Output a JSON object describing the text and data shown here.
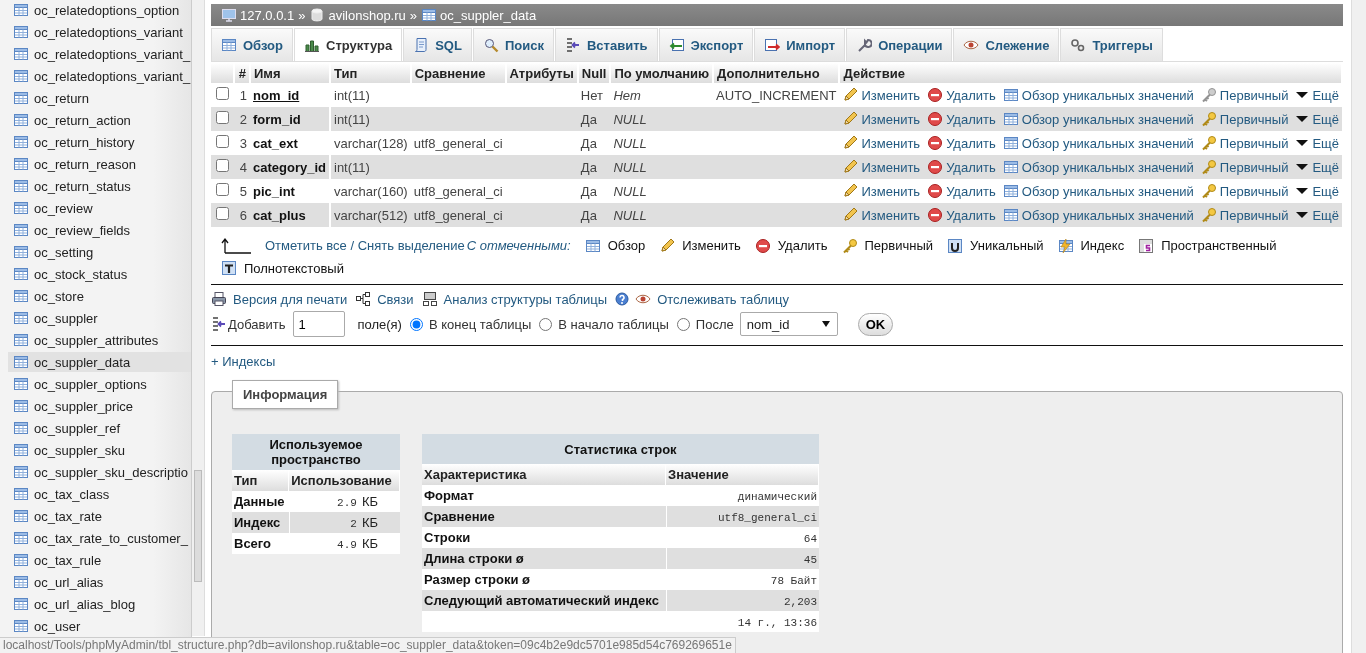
{
  "sidebar": {
    "items": [
      {
        "label": "oc_relatedoptions_option",
        "selected": false
      },
      {
        "label": "oc_relatedoptions_variant",
        "selected": false
      },
      {
        "label": "oc_relatedoptions_variant_",
        "selected": false
      },
      {
        "label": "oc_relatedoptions_variant_",
        "selected": false
      },
      {
        "label": "oc_return",
        "selected": false
      },
      {
        "label": "oc_return_action",
        "selected": false
      },
      {
        "label": "oc_return_history",
        "selected": false
      },
      {
        "label": "oc_return_reason",
        "selected": false
      },
      {
        "label": "oc_return_status",
        "selected": false
      },
      {
        "label": "oc_review",
        "selected": false
      },
      {
        "label": "oc_review_fields",
        "selected": false
      },
      {
        "label": "oc_setting",
        "selected": false
      },
      {
        "label": "oc_stock_status",
        "selected": false
      },
      {
        "label": "oc_store",
        "selected": false
      },
      {
        "label": "oc_suppler",
        "selected": false
      },
      {
        "label": "oc_suppler_attributes",
        "selected": false
      },
      {
        "label": "oc_suppler_data",
        "selected": true
      },
      {
        "label": "oc_suppler_options",
        "selected": false
      },
      {
        "label": "oc_suppler_price",
        "selected": false
      },
      {
        "label": "oc_suppler_ref",
        "selected": false
      },
      {
        "label": "oc_suppler_sku",
        "selected": false
      },
      {
        "label": "oc_suppler_sku_descriptio",
        "selected": false
      },
      {
        "label": "oc_tax_class",
        "selected": false
      },
      {
        "label": "oc_tax_rate",
        "selected": false
      },
      {
        "label": "oc_tax_rate_to_customer_",
        "selected": false
      },
      {
        "label": "oc_tax_rule",
        "selected": false
      },
      {
        "label": "oc_url_alias",
        "selected": false
      },
      {
        "label": "oc_url_alias_blog",
        "selected": false
      },
      {
        "label": "oc_user",
        "selected": false
      }
    ]
  },
  "breadcrumb": [
    {
      "kind": "server",
      "label": "127.0.0.1"
    },
    {
      "kind": "database",
      "separator": "»",
      "label": "avilonshop.ru"
    },
    {
      "kind": "table",
      "separator": "»",
      "label": "oc_suppler_data"
    }
  ],
  "tabs": [
    {
      "kind": "browse",
      "label": "Обзор",
      "selected": false
    },
    {
      "kind": "structure",
      "label": "Структура",
      "selected": true
    },
    {
      "kind": "sql",
      "label": "SQL",
      "selected": false
    },
    {
      "kind": "search",
      "label": "Поиск",
      "selected": false
    },
    {
      "kind": "insert",
      "label": "Вставить",
      "selected": false
    },
    {
      "kind": "export",
      "label": "Экспорт",
      "selected": false
    },
    {
      "kind": "import",
      "label": "Импорт",
      "selected": false
    },
    {
      "kind": "operations",
      "label": "Операции",
      "selected": false
    },
    {
      "kind": "tracking",
      "label": "Слежение",
      "selected": false
    },
    {
      "kind": "triggers",
      "label": "Триггеры",
      "selected": false
    }
  ],
  "structure": {
    "columns": [
      "#",
      "Имя",
      "Тип",
      "Сравнение",
      "Атрибуты",
      "Null",
      "По умолчанию",
      "Дополнительно",
      "Действие"
    ],
    "rows": [
      {
        "num": "1",
        "name": "nom_id",
        "primary": true,
        "checked": false,
        "type": "int(11)",
        "null": "Нет",
        "default": "Нет",
        "extra": "AUTO_INCREMENT",
        "actions": [
          {
            "kind": "edit",
            "label": "Изменить",
            "disabled": false
          },
          {
            "kind": "drop",
            "label": "Удалить",
            "disabled": false
          },
          {
            "kind": "browse",
            "label": "Обзор уникальных значений",
            "disabled": false
          },
          {
            "kind": "primary",
            "label": "Первичный",
            "disabled": true
          },
          {
            "kind": "more",
            "label": "Ещё",
            "disabled": false
          }
        ]
      },
      {
        "num": "2",
        "name": "form_id",
        "primary": false,
        "checked": false,
        "type": "int(11)",
        "null": "Да",
        "default": "NULL",
        "actions": [
          {
            "kind": "edit",
            "label": "Изменить",
            "disabled": false
          },
          {
            "kind": "drop",
            "label": "Удалить",
            "disabled": false
          },
          {
            "kind": "browse",
            "label": "Обзор уникальных значений",
            "disabled": false
          },
          {
            "kind": "primary",
            "label": "Первичный",
            "disabled": false
          },
          {
            "kind": "more",
            "label": "Ещё",
            "disabled": false
          }
        ]
      },
      {
        "num": "3",
        "name": "cat_ext",
        "primary": false,
        "checked": false,
        "type": "varchar(128)",
        "collation": "utf8_general_ci",
        "null": "Да",
        "default": "NULL",
        "actions": [
          {
            "kind": "edit",
            "label": "Изменить",
            "disabled": false
          },
          {
            "kind": "drop",
            "label": "Удалить",
            "disabled": false
          },
          {
            "kind": "browse",
            "label": "Обзор уникальных значений",
            "disabled": false
          },
          {
            "kind": "primary",
            "label": "Первичный",
            "disabled": false
          },
          {
            "kind": "more",
            "label": "Ещё",
            "disabled": false
          }
        ]
      },
      {
        "num": "4",
        "name": "category_id",
        "primary": false,
        "checked": false,
        "type": "int(11)",
        "null": "Да",
        "default": "NULL",
        "actions": [
          {
            "kind": "edit",
            "label": "Изменить",
            "disabled": false
          },
          {
            "kind": "drop",
            "label": "Удалить",
            "disabled": false
          },
          {
            "kind": "browse",
            "label": "Обзор уникальных значений",
            "disabled": false
          },
          {
            "kind": "primary",
            "label": "Первичный",
            "disabled": false
          },
          {
            "kind": "more",
            "label": "Ещё",
            "disabled": false
          }
        ]
      },
      {
        "num": "5",
        "name": "pic_int",
        "primary": false,
        "checked": false,
        "type": "varchar(160)",
        "collation": "utf8_general_ci",
        "null": "Да",
        "default": "NULL",
        "actions": [
          {
            "kind": "edit",
            "label": "Изменить",
            "disabled": false
          },
          {
            "kind": "drop",
            "label": "Удалить",
            "disabled": false
          },
          {
            "kind": "browse",
            "label": "Обзор уникальных значений",
            "disabled": false
          },
          {
            "kind": "primary",
            "label": "Первичный",
            "disabled": false
          },
          {
            "kind": "more",
            "label": "Ещё",
            "disabled": false
          }
        ]
      },
      {
        "num": "6",
        "name": "cat_plus",
        "primary": false,
        "checked": false,
        "type": "varchar(512)",
        "collation": "utf8_general_ci",
        "null": "Да",
        "default": "NULL",
        "actions": [
          {
            "kind": "edit",
            "label": "Изменить",
            "disabled": false
          },
          {
            "kind": "drop",
            "label": "Удалить",
            "disabled": false
          },
          {
            "kind": "browse",
            "label": "Обзор уникальных значений",
            "disabled": false
          },
          {
            "kind": "primary",
            "label": "Первичный",
            "disabled": false
          },
          {
            "kind": "more",
            "label": "Ещё",
            "disabled": false
          }
        ]
      }
    ]
  },
  "bulk": {
    "check_all": "Отметить все / Снять выделение",
    "with_selected": "С отмеченными:",
    "actions": [
      {
        "kind": "browse",
        "label": "Обзор"
      },
      {
        "kind": "edit",
        "label": "Изменить"
      },
      {
        "kind": "drop",
        "label": "Удалить"
      },
      {
        "kind": "primary",
        "label": "Первичный"
      },
      {
        "kind": "unique",
        "label": "Уникальный"
      },
      {
        "kind": "index",
        "label": "Индекс"
      },
      {
        "kind": "spatial",
        "label": "Пространственный"
      },
      {
        "kind": "fulltext",
        "label": "Полнотекстовый"
      }
    ]
  },
  "links": [
    {
      "kind": "print",
      "label": "Версия для печати"
    },
    {
      "kind": "relations",
      "label": "Связи"
    },
    {
      "kind": "analyze",
      "label": "Анализ структуры таблицы"
    },
    {
      "kind": "track",
      "label": "Отслеживать таблицу"
    }
  ],
  "add_field": {
    "label": "Добавить",
    "count": "1",
    "unit": "поле(я)",
    "positions": [
      {
        "label": "В конец таблицы",
        "selected": true
      },
      {
        "label": "В начало таблицы",
        "selected": false
      },
      {
        "label": "После",
        "selected": false
      }
    ],
    "after_column": "nom_id",
    "ok": "OK"
  },
  "indexes_link": "+ Индексы",
  "info": {
    "legend": "Информация",
    "space": {
      "title": "Используемое пространство",
      "columns": [
        "Тип",
        "Использование"
      ],
      "rows": [
        {
          "label": "Данные",
          "value": "2.9",
          "unit": "КБ"
        },
        {
          "label": "Индекс",
          "value": "2",
          "unit": "КБ"
        },
        {
          "label": "Всего",
          "value": "4.9",
          "unit": "КБ"
        }
      ]
    },
    "stats": {
      "title": "Статистика строк",
      "columns": [
        "Характеристика",
        "Значение"
      ],
      "rows": [
        {
          "label": "Формат",
          "value": "динамический"
        },
        {
          "label": "Сравнение",
          "value": "utf8_general_ci"
        },
        {
          "label": "Строки",
          "value": "64"
        },
        {
          "label": "Длина строки ø",
          "value": "45"
        },
        {
          "label": "Размер строки ø",
          "value": "78 Байт"
        },
        {
          "label": "Следующий автоматический индекс",
          "value": "2,203"
        },
        {
          "value": "14 г., 13:36"
        }
      ]
    }
  },
  "status_bar": {
    "url": "localhost/Tools/phpMyAdmin/tbl_structure.php?db=avilonshop.ru&table=oc_suppler_data&token=09c4b2e9dc5701e985d54c769269651e"
  }
}
